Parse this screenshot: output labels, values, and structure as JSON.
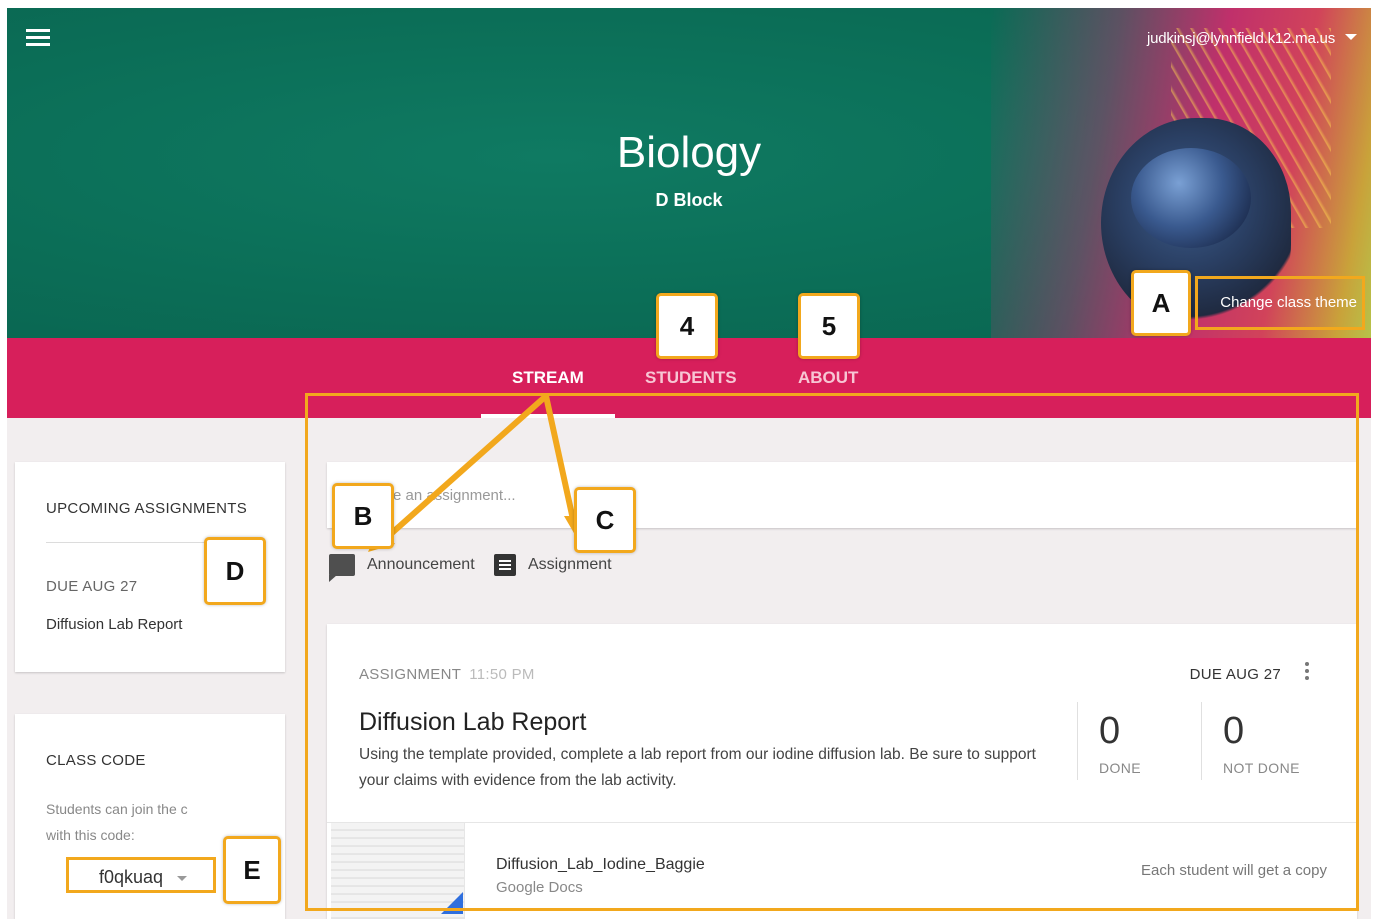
{
  "header": {
    "user_email": "judkinsj@lynnfield.k12.ma.us",
    "class_title": "Biology",
    "class_section": "D Block",
    "change_theme_label": "Change class theme"
  },
  "tabs": [
    {
      "label": "STREAM",
      "active": true
    },
    {
      "label": "STUDENTS",
      "active": false
    },
    {
      "label": "ABOUT",
      "active": false
    }
  ],
  "upcoming": {
    "heading": "UPCOMING ASSIGNMENTS",
    "due_label": "DUE AUG 27",
    "item": "Diffusion Lab Report"
  },
  "class_code": {
    "heading": "CLASS CODE",
    "hint_line1": "Students can join the c",
    "hint_line2": "with this code:",
    "code": "f0qkuaq"
  },
  "compose": {
    "placeholder": "e an assignment...",
    "announcement_label": "Announcement",
    "assignment_label": "Assignment"
  },
  "assignment": {
    "type_label": "ASSIGNMENT",
    "time": "11:50 PM",
    "due": "DUE AUG 27",
    "title": "Diffusion Lab Report",
    "description": "Using the template provided, complete a lab report from our iodine diffusion lab.  Be sure to support your claims with evidence from the lab activity.",
    "done_count": "0",
    "done_label": "DONE",
    "not_done_count": "0",
    "not_done_label": "NOT DONE",
    "attachment_name": "Diffusion_Lab_Iodine_Baggie",
    "attachment_type": "Google Docs",
    "attachment_note": "Each student will get a copy"
  },
  "callouts": {
    "a": "A",
    "b": "B",
    "c": "C",
    "d": "D",
    "e": "E",
    "four": "4",
    "five": "5"
  },
  "colors": {
    "banner": "#0b6e57",
    "tabs_bar": "#d71f5b",
    "annotation": "#f2a81d",
    "doc_accent": "#2f6fde"
  }
}
